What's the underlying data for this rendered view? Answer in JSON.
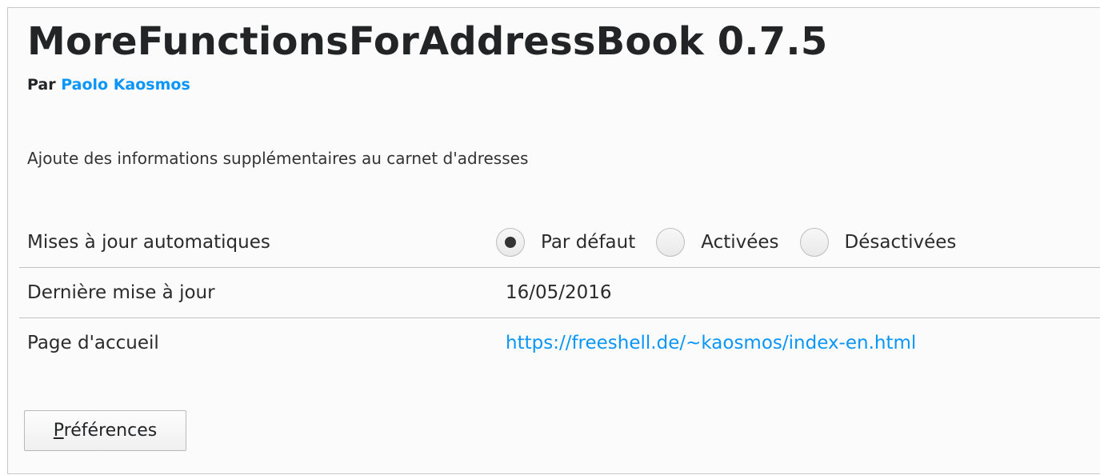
{
  "addon": {
    "title": "MoreFunctionsForAddressBook 0.7.5",
    "by_label": "Par",
    "author": "Paolo Kaosmos",
    "description": "Ajoute des informations supplémentaires au carnet d'adresses"
  },
  "details": {
    "updates": {
      "label": "Mises à jour automatiques",
      "options": [
        "Par défaut",
        "Activées",
        "Désactivées"
      ],
      "selected": "Par défaut"
    },
    "last_update": {
      "label": "Dernière mise à jour",
      "value": "16/05/2016"
    },
    "homepage": {
      "label": "Page d'accueil",
      "value": "https://freeshell.de/~kaosmos/index-en.html"
    }
  },
  "actions": {
    "preferences_accesskey": "P",
    "preferences_rest": "références"
  },
  "colors": {
    "link": "#0996f8",
    "text": "#222426",
    "separator": "#c1c1c1"
  }
}
